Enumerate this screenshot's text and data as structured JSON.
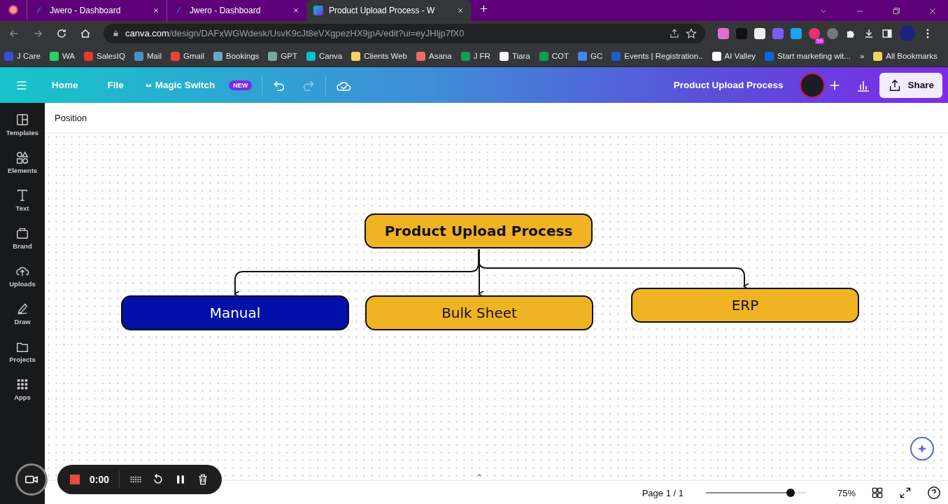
{
  "browser": {
    "tabs": [
      {
        "title": "Jwero - Dashboard",
        "selected": false
      },
      {
        "title": "Jwero - Dashboard",
        "selected": false
      },
      {
        "title": "Product Upload Process - W",
        "selected": true
      }
    ],
    "address": {
      "host": "canva.com",
      "path": "/design/DAFxWGWdesk/UsvK9cJt8eVXgpezHX9jpA/edit?ui=eyJHljp7fX0"
    },
    "extension_badge": "59",
    "bookmarks": [
      "J Care",
      "WA",
      "SalesIQ",
      "Mail",
      "Gmail",
      "Bookings",
      "GPT",
      "Canva",
      "Clients Web",
      "Asana",
      "J FR",
      "Tiara",
      "COT",
      "GC",
      "Events | Registration..",
      "AI Valley",
      "Start marketing wit..."
    ],
    "more_bookmarks": "»",
    "all_bookmarks": "All Bookmarks"
  },
  "editor": {
    "menu": [
      "Home",
      "File"
    ],
    "magic_switch": "Magic Switch",
    "new_badge": "NEW",
    "document_title": "Product Upload Process",
    "share": "Share",
    "sidebar": [
      "Templates",
      "Elements",
      "Text",
      "Brand",
      "Uploads",
      "Draw",
      "Projects",
      "Apps"
    ],
    "context_toolbar": "Position",
    "diagram": {
      "title": "Product Upload Process",
      "nodes": [
        {
          "label": "Manual",
          "color": "#0010a8"
        },
        {
          "label": "Bulk Sheet",
          "color": "#f0b323"
        },
        {
          "label": "ERP",
          "color": "#f0b323"
        }
      ]
    },
    "recorder": {
      "time": "0:00"
    },
    "footer": {
      "page": "Page 1 / 1",
      "zoom": {
        "level": 0.84,
        "reading": "75%"
      }
    }
  }
}
